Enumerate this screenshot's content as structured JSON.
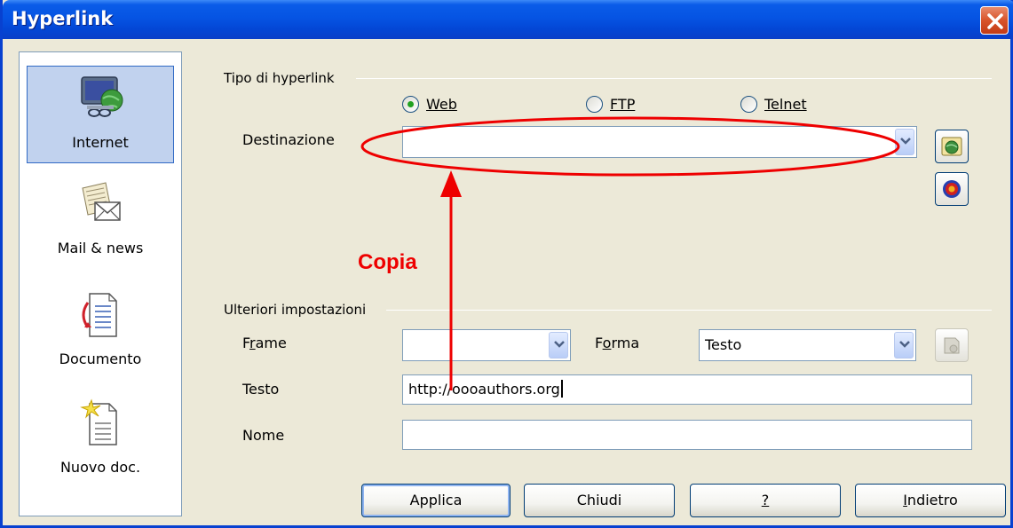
{
  "window": {
    "title": "Hyperlink"
  },
  "sidebar": {
    "items": [
      {
        "label": "Internet",
        "icon": "internet-icon",
        "selected": true
      },
      {
        "label": "Mail & news",
        "icon": "mail-icon",
        "selected": false
      },
      {
        "label": "Documento",
        "icon": "document-icon",
        "selected": false
      },
      {
        "label": "Nuovo doc.",
        "icon": "new-document-icon",
        "selected": false
      }
    ]
  },
  "hyperlink_type": {
    "group_label": "Tipo di hyperlink",
    "options": [
      {
        "label": "Web",
        "selected": true
      },
      {
        "label": "FTP",
        "selected": false
      },
      {
        "label": "Telnet",
        "selected": false
      }
    ],
    "target_label": "Destinazione",
    "target_value": ""
  },
  "further_settings": {
    "group_label": "Ulteriori impostazioni",
    "frame_label": "Frame",
    "frame_value": "",
    "form_label": "Forma",
    "form_value": "Testo",
    "text_label": "Testo",
    "text_value": "http://oooauthors.org",
    "name_label": "Nome",
    "name_value": ""
  },
  "buttons": {
    "apply": "Applica",
    "close": "Chiudi",
    "help": "?",
    "back": "Indietro"
  },
  "annotation": {
    "label": "Copia",
    "color": "#ee0000"
  },
  "colors": {
    "title_bar": "#0654e3",
    "dialog_bg": "#ece9d8",
    "selected_item": "#c1d2ee"
  }
}
